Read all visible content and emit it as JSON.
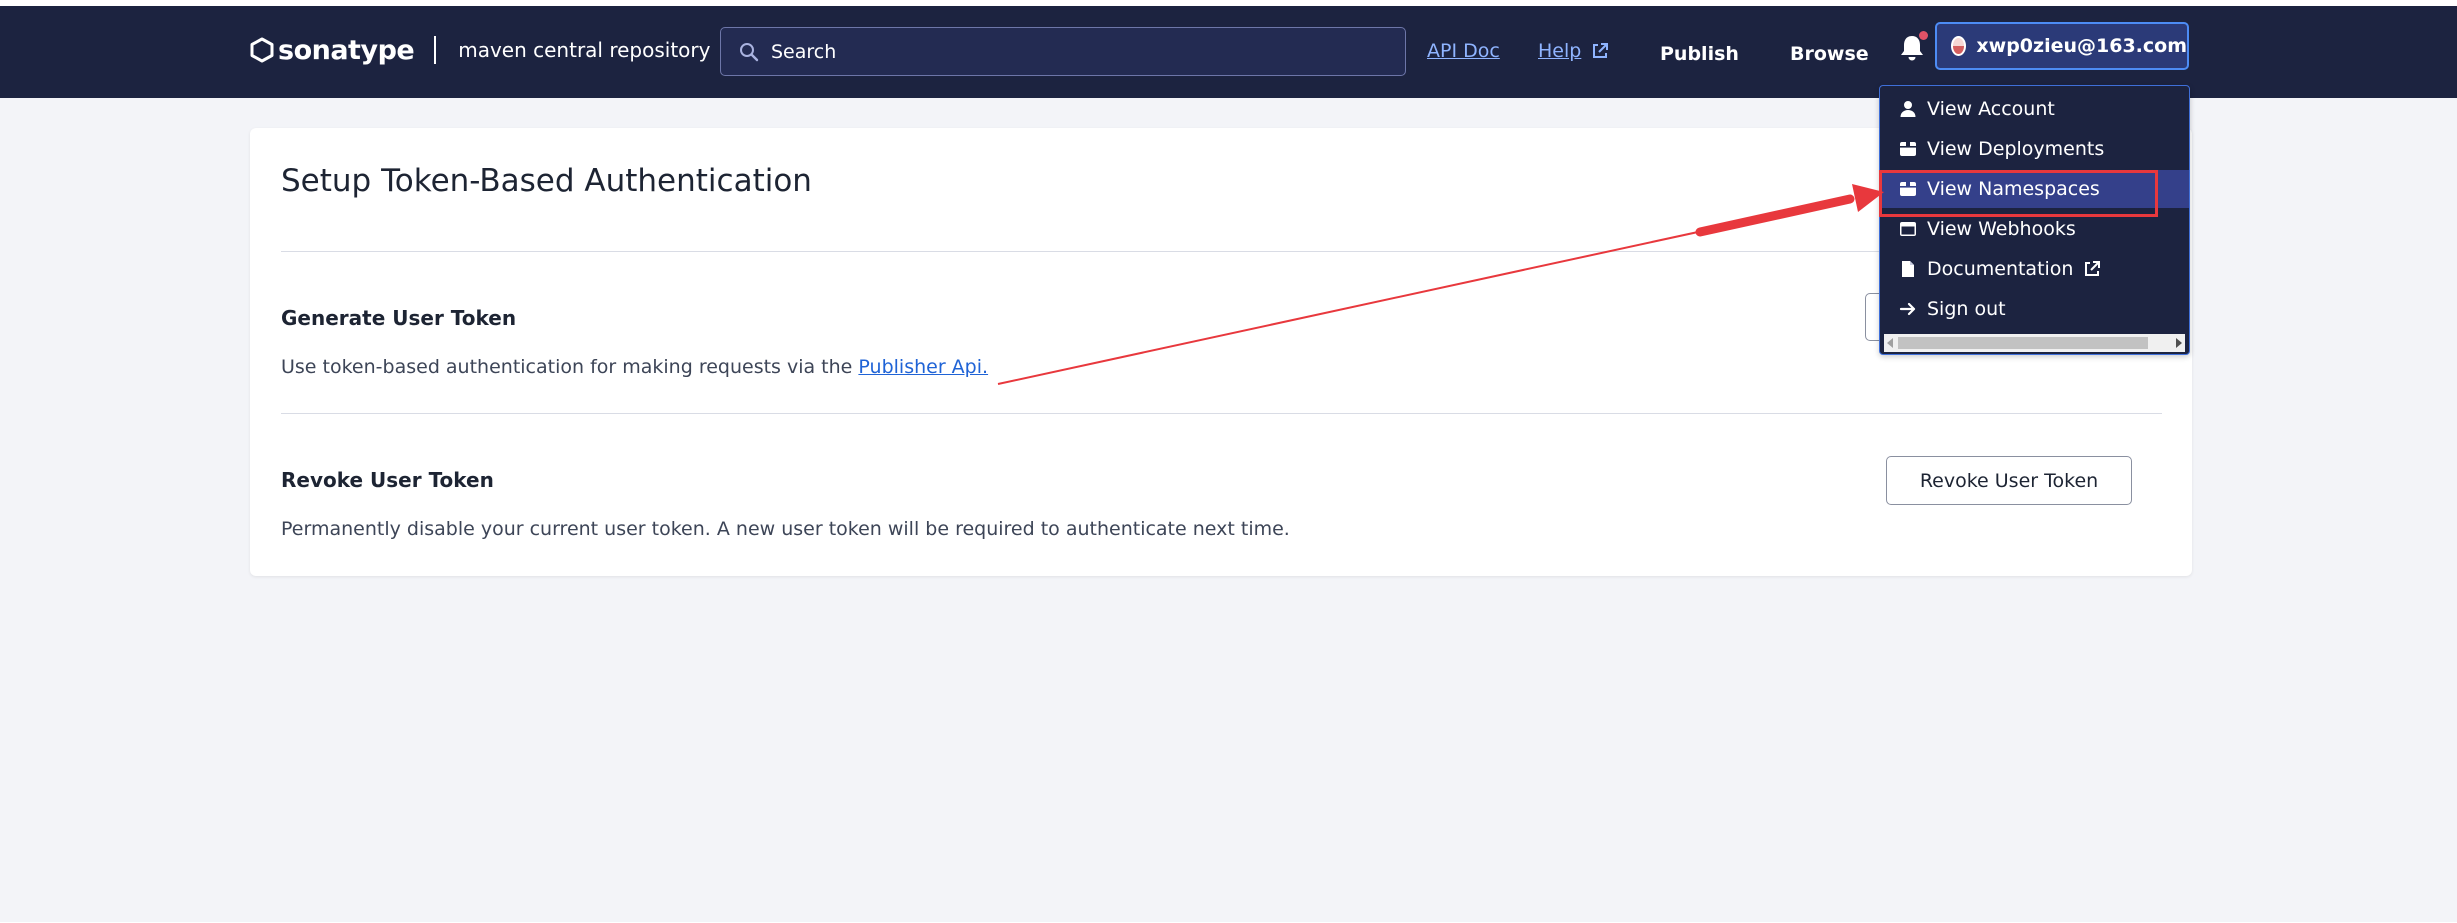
{
  "header": {
    "logo_text": "sonatype",
    "logo_subtitle": "maven central repository",
    "search_placeholder": "Search",
    "nav_api_doc": "API Doc",
    "nav_help": "Help",
    "nav_publish": "Publish",
    "nav_browse": "Browse",
    "account_email": "xwp0zieu@163.com"
  },
  "card": {
    "title": "Setup Token-Based Authentication",
    "generate": {
      "title": "Generate User Token",
      "desc_prefix": "Use token-based authentication for making requests via the ",
      "desc_link": "Publisher Api."
    },
    "revoke": {
      "title": "Revoke User Token",
      "desc": "Permanently disable your current user token. A new user token will be required to authenticate next time.",
      "button_label": "Revoke User Token"
    }
  },
  "menu": {
    "items": [
      {
        "label": "View Account",
        "icon": "user-icon"
      },
      {
        "label": "View Deployments",
        "icon": "package-icon"
      },
      {
        "label": "View Namespaces",
        "icon": "package-icon",
        "active": true
      },
      {
        "label": "View Webhooks",
        "icon": "window-icon"
      },
      {
        "label": "Documentation",
        "icon": "file-icon"
      },
      {
        "label": "Sign out",
        "icon": "arrow-right-icon"
      }
    ]
  },
  "colors": {
    "header_bg": "#1c2340",
    "accent": "#4d8cf5",
    "link": "#1f63d6",
    "annotation_red": "#e8383d",
    "menu_active": "#34408a"
  }
}
